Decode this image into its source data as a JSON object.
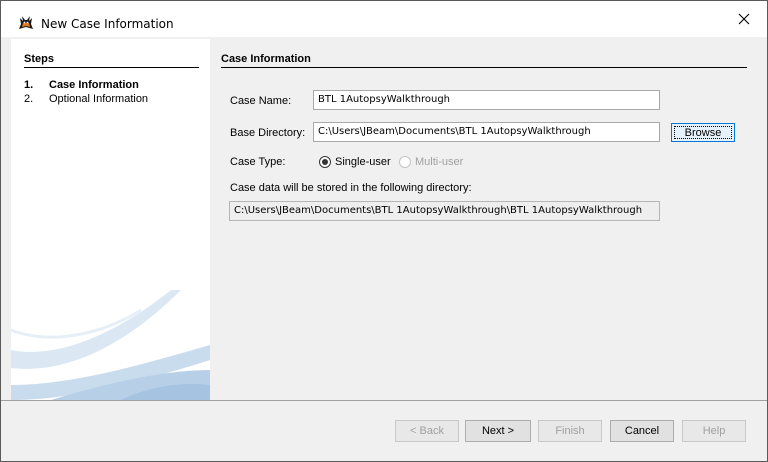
{
  "window": {
    "title": "New Case Information"
  },
  "steps": {
    "title": "Steps",
    "items": [
      {
        "num": "1.",
        "label": "Case Information",
        "active": true
      },
      {
        "num": "2.",
        "label": "Optional Information",
        "active": false
      }
    ]
  },
  "form": {
    "section_title": "Case Information",
    "case_name_label": "Case Name:",
    "case_name_value": "BTL 1AutopsyWalkthrough",
    "base_dir_label": "Base Directory:",
    "base_dir_value": "C:\\Users\\JBeam\\Documents\\BTL 1AutopsyWalkthrough",
    "browse_label": "Browse",
    "case_type_label": "Case Type:",
    "single_user_label": "Single-user",
    "single_user_checked": true,
    "multi_user_label": "Multi-user",
    "multi_user_enabled": false,
    "storage_note": "Case data will be stored in the following directory:",
    "storage_path": "C:\\Users\\JBeam\\Documents\\BTL 1AutopsyWalkthrough\\BTL 1AutopsyWalkthrough"
  },
  "footer": {
    "back_label": "< Back",
    "next_label": "Next >",
    "finish_label": "Finish",
    "cancel_label": "Cancel",
    "help_label": "Help"
  },
  "icons": {
    "app": "autopsy-dog-icon",
    "close": "close-icon"
  }
}
